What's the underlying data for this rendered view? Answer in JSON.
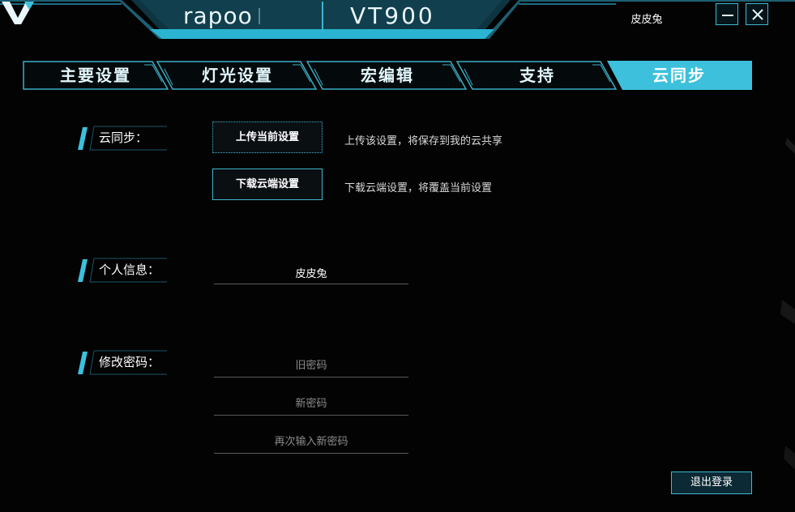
{
  "header": {
    "brand": "rapoo",
    "model": "VT900",
    "user_name": "皮皮兔",
    "minimize_icon": "minimize-icon",
    "close_icon": "close-icon"
  },
  "tabs": [
    {
      "label": "主要设置",
      "active": false
    },
    {
      "label": "灯光设置",
      "active": false
    },
    {
      "label": "宏编辑",
      "active": false
    },
    {
      "label": "支持",
      "active": false
    },
    {
      "label": "云同步",
      "active": true
    }
  ],
  "cloud_sync": {
    "label": "云同步：",
    "upload_button": "上传当前设置",
    "upload_desc": "上传该设置，将保存到我的云共享",
    "download_button": "下载云端设置",
    "download_desc": "下载云端设置，将覆盖当前设置"
  },
  "personal_info": {
    "label": "个人信息：",
    "nickname": "皮皮兔"
  },
  "change_password": {
    "label": "修改密码：",
    "old_placeholder": "旧密码",
    "new_placeholder": "新密码",
    "confirm_placeholder": "再次输入新密码"
  },
  "logout_button": "退出登录",
  "colors": {
    "accent": "#42b8d2",
    "active_tab": "#3cc0dc",
    "background": "#030303"
  }
}
